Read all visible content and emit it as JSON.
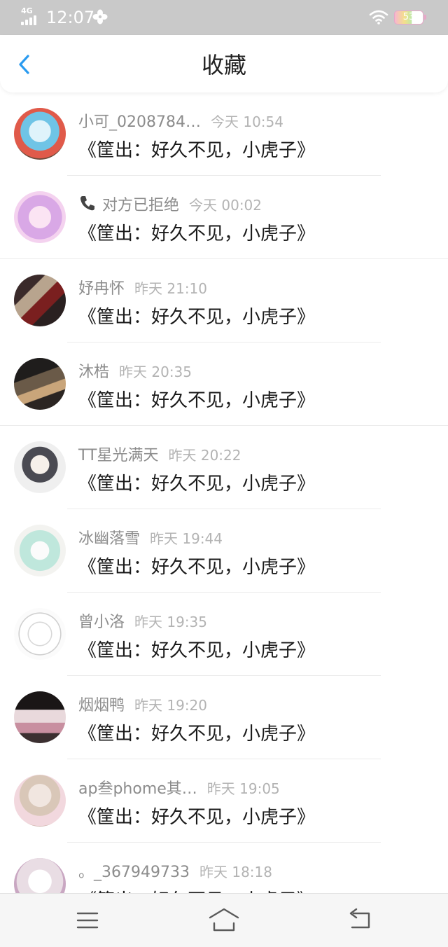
{
  "status_bar": {
    "network": "4G",
    "time": "12:07",
    "battery": "53"
  },
  "header": {
    "title": "收藏",
    "back_icon": "chevron-left-icon"
  },
  "colors": {
    "accent": "#2a9bf0",
    "status_bar_bg": "#c9c9c9",
    "name_text": "#8c8c8c",
    "time_text": "#b3b3b3"
  },
  "items": [
    {
      "name": "小可_0208784…",
      "time": "今天 10:54",
      "message": "《筐出：好久不见，小虎子》"
    },
    {
      "name": "对方已拒绝",
      "time": "今天 00:02",
      "message": "《筐出：好久不见，小虎子》",
      "icon": "phone-icon"
    },
    {
      "name": "妤冉怀",
      "time": "昨天 21:10",
      "message": "《筐出：好久不见，小虎子》"
    },
    {
      "name": "沐梏",
      "time": "昨天 20:35",
      "message": "《筐出：好久不见，小虎子》"
    },
    {
      "name": "TT星光满天",
      "time": "昨天 20:22",
      "message": "《筐出：好久不见，小虎子》"
    },
    {
      "name": "冰幽落雪",
      "time": "昨天 19:44",
      "message": "《筐出：好久不见，小虎子》"
    },
    {
      "name": "曾小洛",
      "time": "昨天 19:35",
      "message": "《筐出：好久不见，小虎子》"
    },
    {
      "name": "烟烟鸭",
      "time": "昨天 19:20",
      "message": "《筐出：好久不见，小虎子》"
    },
    {
      "name": "ap叁phome其…",
      "time": "昨天 19:05",
      "message": "《筐出：好久不见，小虎子》"
    },
    {
      "name": "。_367949733",
      "time": "昨天 18:18",
      "message": "《筐出：好久不见，小虎子》"
    }
  ],
  "navbar": {
    "menu_icon": "menu-icon",
    "home_icon": "home-icon",
    "back_icon": "back-icon"
  }
}
